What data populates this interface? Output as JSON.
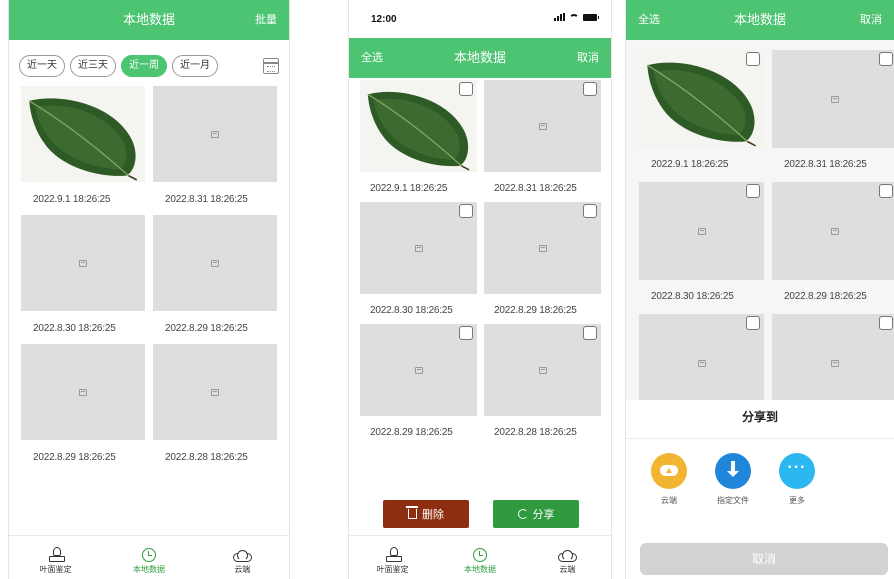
{
  "colors": {
    "brand_green": "#4cc471",
    "delete_red": "#8e2e10",
    "share_green": "#2f9a3e",
    "cloud_yellow": "#f2b531",
    "file_blue": "#1f86d9",
    "more_cyan": "#2bb7f0"
  },
  "screen1": {
    "header": {
      "title": "本地数据",
      "right": "批量"
    },
    "filters": [
      "近一天",
      "近三天",
      "近一周",
      "近一月"
    ],
    "active_filter": "近一周",
    "items": [
      {
        "time": "2022.9.1  18:26:25",
        "has_image": true
      },
      {
        "time": "2022.8.31  18:26:25",
        "has_image": false
      },
      {
        "time": "2022.8.30  18:26:25",
        "has_image": false
      },
      {
        "time": "2022.8.29  18:26:25",
        "has_image": false
      },
      {
        "time": "2022.8.29  18:26:25",
        "has_image": false
      },
      {
        "time": "2022.8.28  18:26:25",
        "has_image": false
      }
    ],
    "tabs": [
      "叶面鉴定",
      "本地数据",
      "云端"
    ],
    "active_tab": "本地数据"
  },
  "screen2": {
    "status_time": "12:00",
    "header": {
      "left": "全选",
      "title": "本地数据",
      "right": "取消"
    },
    "items": [
      {
        "time": "2022.9.1  18:26:25",
        "has_image": true
      },
      {
        "time": "2022.8.31  18:26:25",
        "has_image": false
      },
      {
        "time": "2022.8.30  18:26:25",
        "has_image": false
      },
      {
        "time": "2022.8.29  18:26:25",
        "has_image": false
      },
      {
        "time": "2022.8.29  18:26:25",
        "has_image": false
      },
      {
        "time": "2022.8.28  18:26:25",
        "has_image": false
      }
    ],
    "delete_label": "删除",
    "share_label": "分享",
    "tabs": [
      "叶面鉴定",
      "本地数据",
      "云端"
    ],
    "active_tab": "本地数据"
  },
  "screen3": {
    "header": {
      "left": "全选",
      "title": "本地数据",
      "right": "取消"
    },
    "items": [
      {
        "time": "2022.9.1  18:26:25",
        "has_image": true
      },
      {
        "time": "2022.8.31  18:26:25",
        "has_image": false
      },
      {
        "time": "2022.8.30  18:26:25",
        "has_image": false
      },
      {
        "time": "2022.8.29  18:26:25",
        "has_image": false
      },
      {
        "time": "",
        "has_image": false
      },
      {
        "time": "",
        "has_image": false
      }
    ],
    "share_sheet": {
      "title": "分享到",
      "options": [
        {
          "label": "云端",
          "icon": "cloud-upload-icon"
        },
        {
          "label": "指定文件",
          "icon": "download-icon"
        },
        {
          "label": "更多",
          "icon": "more-icon"
        }
      ],
      "cancel_label": "取消"
    }
  }
}
